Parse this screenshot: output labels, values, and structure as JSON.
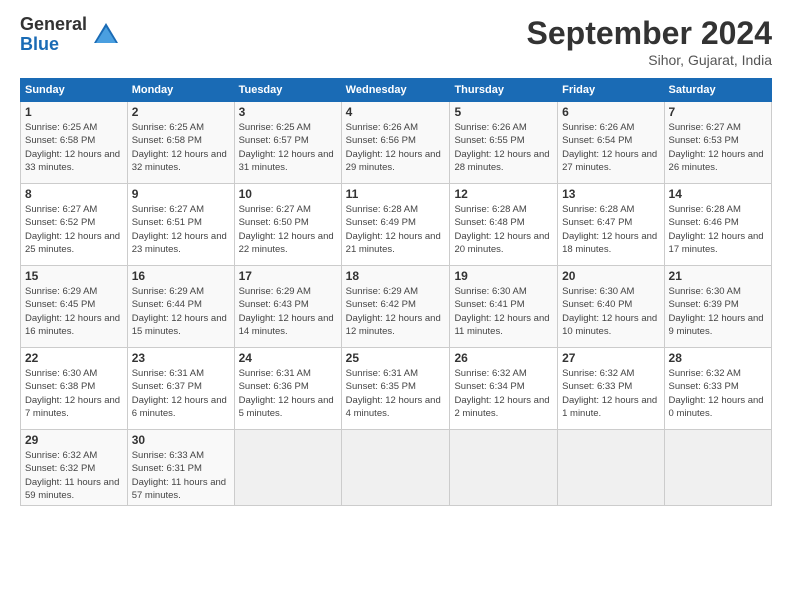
{
  "header": {
    "logo_general": "General",
    "logo_blue": "Blue",
    "month_title": "September 2024",
    "location": "Sihor, Gujarat, India"
  },
  "days_of_week": [
    "Sunday",
    "Monday",
    "Tuesday",
    "Wednesday",
    "Thursday",
    "Friday",
    "Saturday"
  ],
  "weeks": [
    [
      {
        "day": "1",
        "sunrise": "6:25 AM",
        "sunset": "6:58 PM",
        "daylight": "12 hours and 33 minutes."
      },
      {
        "day": "2",
        "sunrise": "6:25 AM",
        "sunset": "6:58 PM",
        "daylight": "12 hours and 32 minutes."
      },
      {
        "day": "3",
        "sunrise": "6:25 AM",
        "sunset": "6:57 PM",
        "daylight": "12 hours and 31 minutes."
      },
      {
        "day": "4",
        "sunrise": "6:26 AM",
        "sunset": "6:56 PM",
        "daylight": "12 hours and 29 minutes."
      },
      {
        "day": "5",
        "sunrise": "6:26 AM",
        "sunset": "6:55 PM",
        "daylight": "12 hours and 28 minutes."
      },
      {
        "day": "6",
        "sunrise": "6:26 AM",
        "sunset": "6:54 PM",
        "daylight": "12 hours and 27 minutes."
      },
      {
        "day": "7",
        "sunrise": "6:27 AM",
        "sunset": "6:53 PM",
        "daylight": "12 hours and 26 minutes."
      }
    ],
    [
      {
        "day": "8",
        "sunrise": "6:27 AM",
        "sunset": "6:52 PM",
        "daylight": "12 hours and 25 minutes."
      },
      {
        "day": "9",
        "sunrise": "6:27 AM",
        "sunset": "6:51 PM",
        "daylight": "12 hours and 23 minutes."
      },
      {
        "day": "10",
        "sunrise": "6:27 AM",
        "sunset": "6:50 PM",
        "daylight": "12 hours and 22 minutes."
      },
      {
        "day": "11",
        "sunrise": "6:28 AM",
        "sunset": "6:49 PM",
        "daylight": "12 hours and 21 minutes."
      },
      {
        "day": "12",
        "sunrise": "6:28 AM",
        "sunset": "6:48 PM",
        "daylight": "12 hours and 20 minutes."
      },
      {
        "day": "13",
        "sunrise": "6:28 AM",
        "sunset": "6:47 PM",
        "daylight": "12 hours and 18 minutes."
      },
      {
        "day": "14",
        "sunrise": "6:28 AM",
        "sunset": "6:46 PM",
        "daylight": "12 hours and 17 minutes."
      }
    ],
    [
      {
        "day": "15",
        "sunrise": "6:29 AM",
        "sunset": "6:45 PM",
        "daylight": "12 hours and 16 minutes."
      },
      {
        "day": "16",
        "sunrise": "6:29 AM",
        "sunset": "6:44 PM",
        "daylight": "12 hours and 15 minutes."
      },
      {
        "day": "17",
        "sunrise": "6:29 AM",
        "sunset": "6:43 PM",
        "daylight": "12 hours and 14 minutes."
      },
      {
        "day": "18",
        "sunrise": "6:29 AM",
        "sunset": "6:42 PM",
        "daylight": "12 hours and 12 minutes."
      },
      {
        "day": "19",
        "sunrise": "6:30 AM",
        "sunset": "6:41 PM",
        "daylight": "12 hours and 11 minutes."
      },
      {
        "day": "20",
        "sunrise": "6:30 AM",
        "sunset": "6:40 PM",
        "daylight": "12 hours and 10 minutes."
      },
      {
        "day": "21",
        "sunrise": "6:30 AM",
        "sunset": "6:39 PM",
        "daylight": "12 hours and 9 minutes."
      }
    ],
    [
      {
        "day": "22",
        "sunrise": "6:30 AM",
        "sunset": "6:38 PM",
        "daylight": "12 hours and 7 minutes."
      },
      {
        "day": "23",
        "sunrise": "6:31 AM",
        "sunset": "6:37 PM",
        "daylight": "12 hours and 6 minutes."
      },
      {
        "day": "24",
        "sunrise": "6:31 AM",
        "sunset": "6:36 PM",
        "daylight": "12 hours and 5 minutes."
      },
      {
        "day": "25",
        "sunrise": "6:31 AM",
        "sunset": "6:35 PM",
        "daylight": "12 hours and 4 minutes."
      },
      {
        "day": "26",
        "sunrise": "6:32 AM",
        "sunset": "6:34 PM",
        "daylight": "12 hours and 2 minutes."
      },
      {
        "day": "27",
        "sunrise": "6:32 AM",
        "sunset": "6:33 PM",
        "daylight": "12 hours and 1 minute."
      },
      {
        "day": "28",
        "sunrise": "6:32 AM",
        "sunset": "6:33 PM",
        "daylight": "12 hours and 0 minutes."
      }
    ],
    [
      {
        "day": "29",
        "sunrise": "6:32 AM",
        "sunset": "6:32 PM",
        "daylight": "11 hours and 59 minutes."
      },
      {
        "day": "30",
        "sunrise": "6:33 AM",
        "sunset": "6:31 PM",
        "daylight": "11 hours and 57 minutes."
      },
      null,
      null,
      null,
      null,
      null
    ]
  ]
}
